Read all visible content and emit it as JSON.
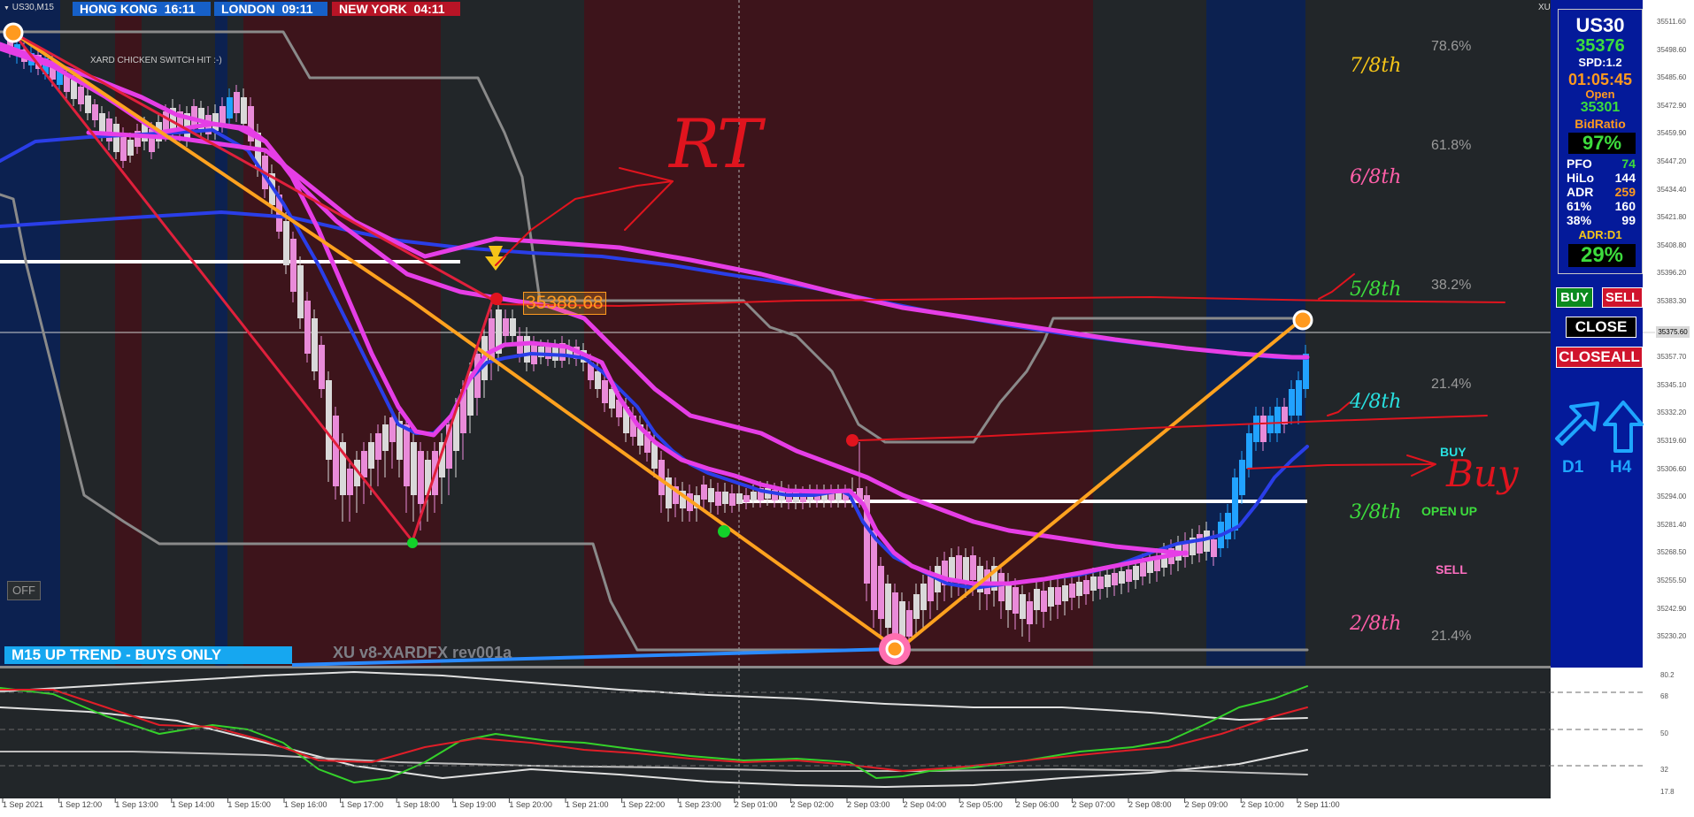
{
  "window": {
    "symbol_label": "US30,M15",
    "corner_label": "XU"
  },
  "session_clocks": [
    {
      "name": "HONG KONG",
      "time": "16:11"
    },
    {
      "name": "LONDON",
      "time": "09:11"
    },
    {
      "name": "NEW YORK",
      "time": "04:11"
    }
  ],
  "chart_texts": {
    "switch_note": "XARD CHICKEN SWITCH HIT :-)",
    "off_button": "OFF",
    "trend_banner": "M15 UP TREND - BUYS ONLY",
    "watermark": "XU v8-XARDFX rev001a",
    "pivot_price_label": "35388.68",
    "signal_buy": "BUY",
    "signal_open_up": "OPEN UP",
    "signal_sell": "SELL"
  },
  "murrey_levels": [
    {
      "label": "7/8th",
      "color": "#f5c518"
    },
    {
      "label": "6/8th",
      "color": "#ff5fa8"
    },
    {
      "label": "5/8th",
      "color": "#3ddc3d"
    },
    {
      "label": "4/8th",
      "color": "#28e0e0"
    },
    {
      "label": "3/8th",
      "color": "#3ddc3d"
    },
    {
      "label": "2/8th",
      "color": "#ff5fa8"
    }
  ],
  "fib_levels": [
    "78.6%",
    "61.8%",
    "38.2%",
    "21.4%",
    "21.4%"
  ],
  "price_axis": {
    "ticks": [
      "35511.60",
      "35498.60",
      "35485.60",
      "35472.90",
      "35459.90",
      "35447.20",
      "35434.40",
      "35421.80",
      "35408.80",
      "35396.20",
      "35383.30",
      "35370.70",
      "35357.70",
      "35345.10",
      "35332.20",
      "35319.60",
      "35306.60",
      "35294.00",
      "35281.40",
      "35268.50",
      "35255.50",
      "35242.90",
      "35230.20"
    ],
    "current": "35375.60"
  },
  "osc_axis": {
    "ticks": [
      "80.2",
      "68",
      "50",
      "32",
      "17.8"
    ]
  },
  "time_axis": {
    "ticks": [
      "1 Sep 2021",
      "1 Sep 12:00",
      "1 Sep 13:00",
      "1 Sep 14:00",
      "1 Sep 15:00",
      "1 Sep 16:00",
      "1 Sep 17:00",
      "1 Sep 18:00",
      "1 Sep 19:00",
      "1 Sep 20:00",
      "1 Sep 21:00",
      "1 Sep 22:00",
      "1 Sep 23:00",
      "2 Sep 01:00",
      "2 Sep 02:00",
      "2 Sep 03:00",
      "2 Sep 04:00",
      "2 Sep 05:00",
      "2 Sep 06:00",
      "2 Sep 07:00",
      "2 Sep 08:00",
      "2 Sep 09:00",
      "2 Sep 10:00",
      "2 Sep 11:00"
    ]
  },
  "info_panel": {
    "symbol": "US30",
    "price": "35376",
    "spread": "SPD:1.2",
    "timer": "01:05:45",
    "open_label": "Open",
    "open_value": "35301",
    "bid_ratio_label": "BidRatio",
    "bid_ratio_value": "97%",
    "stats": [
      {
        "label": "PFO",
        "value": "74",
        "color": "#3ddc3d"
      },
      {
        "label": "HiLo",
        "value": "144",
        "color": "#ffffff"
      },
      {
        "label": "ADR",
        "value": "259",
        "color": "#ff9a1f"
      },
      {
        "label": "61%",
        "value": "160",
        "color": "#ffffff"
      },
      {
        "label": "38%",
        "value": "99",
        "color": "#ffffff"
      }
    ],
    "adr_label": "ADR:D1",
    "adr_value": "29%"
  },
  "trade_buttons": {
    "buy": "BUY",
    "sell": "SELL",
    "close": "CLOSE",
    "close_all": "CLOSEALL"
  },
  "trend_arrows": [
    {
      "label": "D1"
    },
    {
      "label": "H4"
    }
  ],
  "handwriting": {
    "rt": "RT",
    "buy": "Buy"
  },
  "colors": {
    "chart_bg": "#222629",
    "session_red": "#3d141b",
    "session_blue": "#0c2150",
    "panel_blue": "#041a9a",
    "magenta": "#e63ee6",
    "blue_ma": "#2a3ee8",
    "orange": "#ffa21f",
    "bull_candle": "#d9d9d9",
    "bear_candle": "#e98bd9",
    "buy_green": "#0b8a1e",
    "sell_red": "#d0142c"
  }
}
